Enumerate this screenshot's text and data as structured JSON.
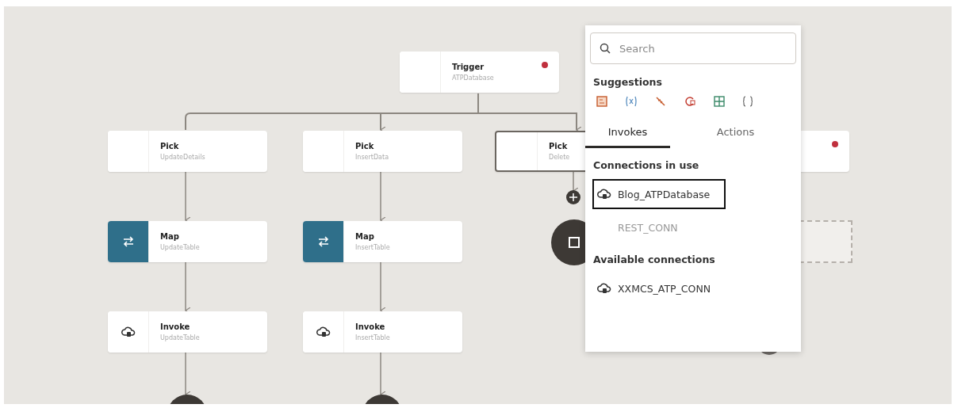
{
  "nodes": [
    {
      "kind": "trigger",
      "title": "Trigger",
      "subtitle": "ATPDatabase",
      "error": true,
      "selected": false
    },
    {
      "kind": "pick",
      "title": "Pick",
      "subtitle": "UpdateDetails",
      "error": false,
      "selected": false
    },
    {
      "kind": "pick",
      "title": "Pick",
      "subtitle": "InsertData",
      "error": false,
      "selected": false
    },
    {
      "kind": "pick",
      "title": "Pick",
      "subtitle": "Delete",
      "error": false,
      "selected": true
    },
    {
      "kind": "pick",
      "error": true,
      "selected": false
    },
    {
      "kind": "map",
      "title": "Map",
      "subtitle": "UpdateTable",
      "error": false,
      "selected": false
    },
    {
      "kind": "map",
      "title": "Map",
      "subtitle": "InsertTable",
      "error": false,
      "selected": false
    },
    {
      "kind": "invoke",
      "title": "Invoke",
      "subtitle": "UpdateTable",
      "error": false,
      "selected": false
    },
    {
      "kind": "invoke",
      "title": "Invoke",
      "subtitle": "InsertTable",
      "error": false,
      "selected": false
    }
  ],
  "popup": {
    "search": {
      "placeholder": "Search"
    },
    "suggestions_title": "Suggestions",
    "tabs": [
      {
        "label": "Invokes",
        "selected": true
      },
      {
        "label": "Actions",
        "selected": false
      }
    ],
    "sections": [
      {
        "title": "Connections in use",
        "items": [
          {
            "label": "Blog_ATPDatabase",
            "kind": "adapter",
            "highlighted": true,
            "disabled": false
          },
          {
            "label": "REST_CONN",
            "kind": "plain",
            "highlighted": false,
            "disabled": true
          }
        ]
      },
      {
        "title": "Available connections",
        "items": [
          {
            "label": "XXMCS_ATP_CONN",
            "kind": "adapter",
            "highlighted": false,
            "disabled": false
          }
        ]
      }
    ]
  }
}
